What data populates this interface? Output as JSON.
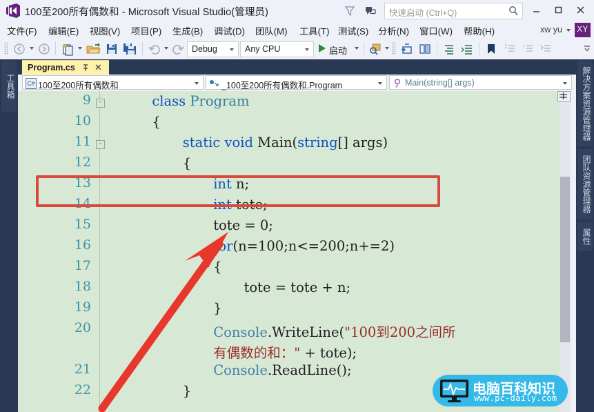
{
  "window": {
    "title": "100至200所有偶数和 - Microsoft Visual Studio(管理员)",
    "minimize_label": "minimize",
    "maximize_label": "maximize",
    "close_label": "close"
  },
  "titlebar": {
    "feedback_icon": "funnel-icon",
    "notify_icon": "feedback-icon",
    "quick_launch_placeholder": "快速启动 (Ctrl+Q)",
    "quick_launch_value": "",
    "search_icon": "magnifier-icon"
  },
  "menu": {
    "items": [
      {
        "label": "文件(F)",
        "key": "F"
      },
      {
        "label": "编辑(E)",
        "key": "E"
      },
      {
        "label": "视图(V)",
        "key": "V"
      },
      {
        "label": "项目(P)",
        "key": "P"
      },
      {
        "label": "生成(B)",
        "key": "B"
      },
      {
        "label": "调试(D)",
        "key": "D"
      },
      {
        "label": "团队(M)",
        "key": "M"
      },
      {
        "label": "工具(T)",
        "key": "T"
      },
      {
        "label": "测试(S)",
        "key": "S"
      },
      {
        "label": "分析(N)",
        "key": "N"
      },
      {
        "label": "窗口(W)",
        "key": "W"
      },
      {
        "label": "帮助(H)",
        "key": "H"
      }
    ],
    "user": "xw yu",
    "avatar_initials": "XY"
  },
  "toolbar": {
    "config": "Debug",
    "platform": "Any CPU",
    "blank_combo": "",
    "start_label": "启动",
    "icons": [
      "navigate-back-icon",
      "navigate-forward-icon",
      "new-project-icon",
      "open-file-icon",
      "save-icon",
      "save-all-icon",
      "undo-icon",
      "redo-icon",
      "find-icon",
      "step-into-icon",
      "step-over-icon",
      "indent-icon",
      "outdent-icon",
      "bookmark-icon",
      "comment-icon",
      "uncomment-icon",
      "collapse-icon",
      "overflow-icon"
    ]
  },
  "docks": {
    "left": [
      {
        "label": "工具箱",
        "name": "toolbox"
      }
    ],
    "right": [
      {
        "label": "解决方案资源管理器",
        "name": "solution-explorer"
      },
      {
        "label": "团队资源管理器",
        "name": "team-explorer"
      },
      {
        "label": "属性",
        "name": "properties"
      }
    ]
  },
  "editor": {
    "tab": {
      "filename": "Program.cs",
      "pin_icon": "pin-icon",
      "close_icon": "close-icon"
    },
    "nav": {
      "project": "100至200所有偶数和",
      "project_icon": "csharp-file-icon",
      "type": "_100至200所有偶数和.Program",
      "type_icon": "class-icon",
      "member": "Main(string[] args)",
      "member_icon": "method-icon"
    },
    "scroll": {
      "split_icon": "split-view-icon",
      "up_icon": "scroll-up-icon"
    },
    "wrap_glyph": "↵",
    "first_line": 9,
    "lines": [
      {
        "no": "9",
        "fold": "-",
        "indent": 4,
        "tokens": [
          {
            "t": "class ",
            "c": "kw"
          },
          {
            "t": "Program",
            "c": "ty"
          }
        ]
      },
      {
        "no": "10",
        "fold": "",
        "indent": 4,
        "tokens": [
          {
            "t": "{",
            "c": ""
          }
        ]
      },
      {
        "no": "11",
        "fold": "-",
        "indent": 8,
        "tokens": [
          {
            "t": "static ",
            "c": "kw"
          },
          {
            "t": "void ",
            "c": "kw"
          },
          {
            "t": "Main(",
            "c": ""
          },
          {
            "t": "string",
            "c": "kw"
          },
          {
            "t": "[] args)",
            "c": ""
          }
        ]
      },
      {
        "no": "12",
        "fold": "",
        "indent": 8,
        "tokens": [
          {
            "t": "{",
            "c": ""
          }
        ]
      },
      {
        "no": "13",
        "fold": "",
        "indent": 12,
        "tokens": [
          {
            "t": "int",
            "c": "kw"
          },
          {
            "t": " n;",
            "c": ""
          }
        ]
      },
      {
        "no": "14",
        "fold": "",
        "indent": 12,
        "tokens": [
          {
            "t": "int",
            "c": "kw"
          },
          {
            "t": " tote;",
            "c": ""
          }
        ]
      },
      {
        "no": "15",
        "fold": "",
        "indent": 12,
        "tokens": [
          {
            "t": "tote = 0;",
            "c": ""
          }
        ]
      },
      {
        "no": "16",
        "fold": "",
        "indent": 12,
        "tokens": [
          {
            "t": "for",
            "c": "kw"
          },
          {
            "t": "(n=100;n<=200;n+=2)",
            "c": ""
          }
        ]
      },
      {
        "no": "17",
        "fold": "",
        "indent": 12,
        "tokens": [
          {
            "t": "{",
            "c": ""
          }
        ]
      },
      {
        "no": "18",
        "fold": "",
        "indent": 16,
        "tokens": [
          {
            "t": "tote = tote + n;",
            "c": ""
          }
        ]
      },
      {
        "no": "19",
        "fold": "",
        "indent": 12,
        "tokens": [
          {
            "t": "}",
            "c": ""
          }
        ]
      },
      {
        "no": "20",
        "fold": "",
        "indent": 12,
        "wrap": true,
        "tokens": [
          {
            "t": "Console",
            "c": "bluefn"
          },
          {
            "t": ".WriteLine(",
            "c": ""
          },
          {
            "t": "\"100到200之间所",
            "c": "st"
          }
        ]
      },
      {
        "no": "",
        "fold": "",
        "indent": 12,
        "tokens": [
          {
            "t": "有偶数的和：\"",
            "c": "st"
          },
          {
            "t": " + tote);",
            "c": ""
          }
        ]
      },
      {
        "no": "21",
        "fold": "",
        "indent": 12,
        "tokens": [
          {
            "t": "Console",
            "c": "bluefn"
          },
          {
            "t": ".ReadLine();",
            "c": ""
          }
        ]
      },
      {
        "no": "22",
        "fold": "",
        "indent": 8,
        "tokens": [
          {
            "t": "}",
            "c": ""
          }
        ]
      }
    ]
  },
  "annotations": {
    "highlight_rect_label": "for-loop-highlight",
    "arrow_label": "red-arrow-pointer",
    "arrow_color": "#e8372c",
    "rect_color": "#d94a3d"
  },
  "watermark": {
    "title": "电脑百科知识",
    "url": "www.pc-daily.com",
    "brand_color": "#34b9e8"
  },
  "colors": {
    "chrome": "#eef1f8",
    "dock": "#293955",
    "editor_bg": "#d7e8d5",
    "tab_active": "#fdf1ac",
    "line_number": "#3f93a8",
    "keyword": "#0f4fbf",
    "type": "#2f7f9f",
    "string": "#9b2c2c",
    "accent_purple": "#68217a"
  }
}
